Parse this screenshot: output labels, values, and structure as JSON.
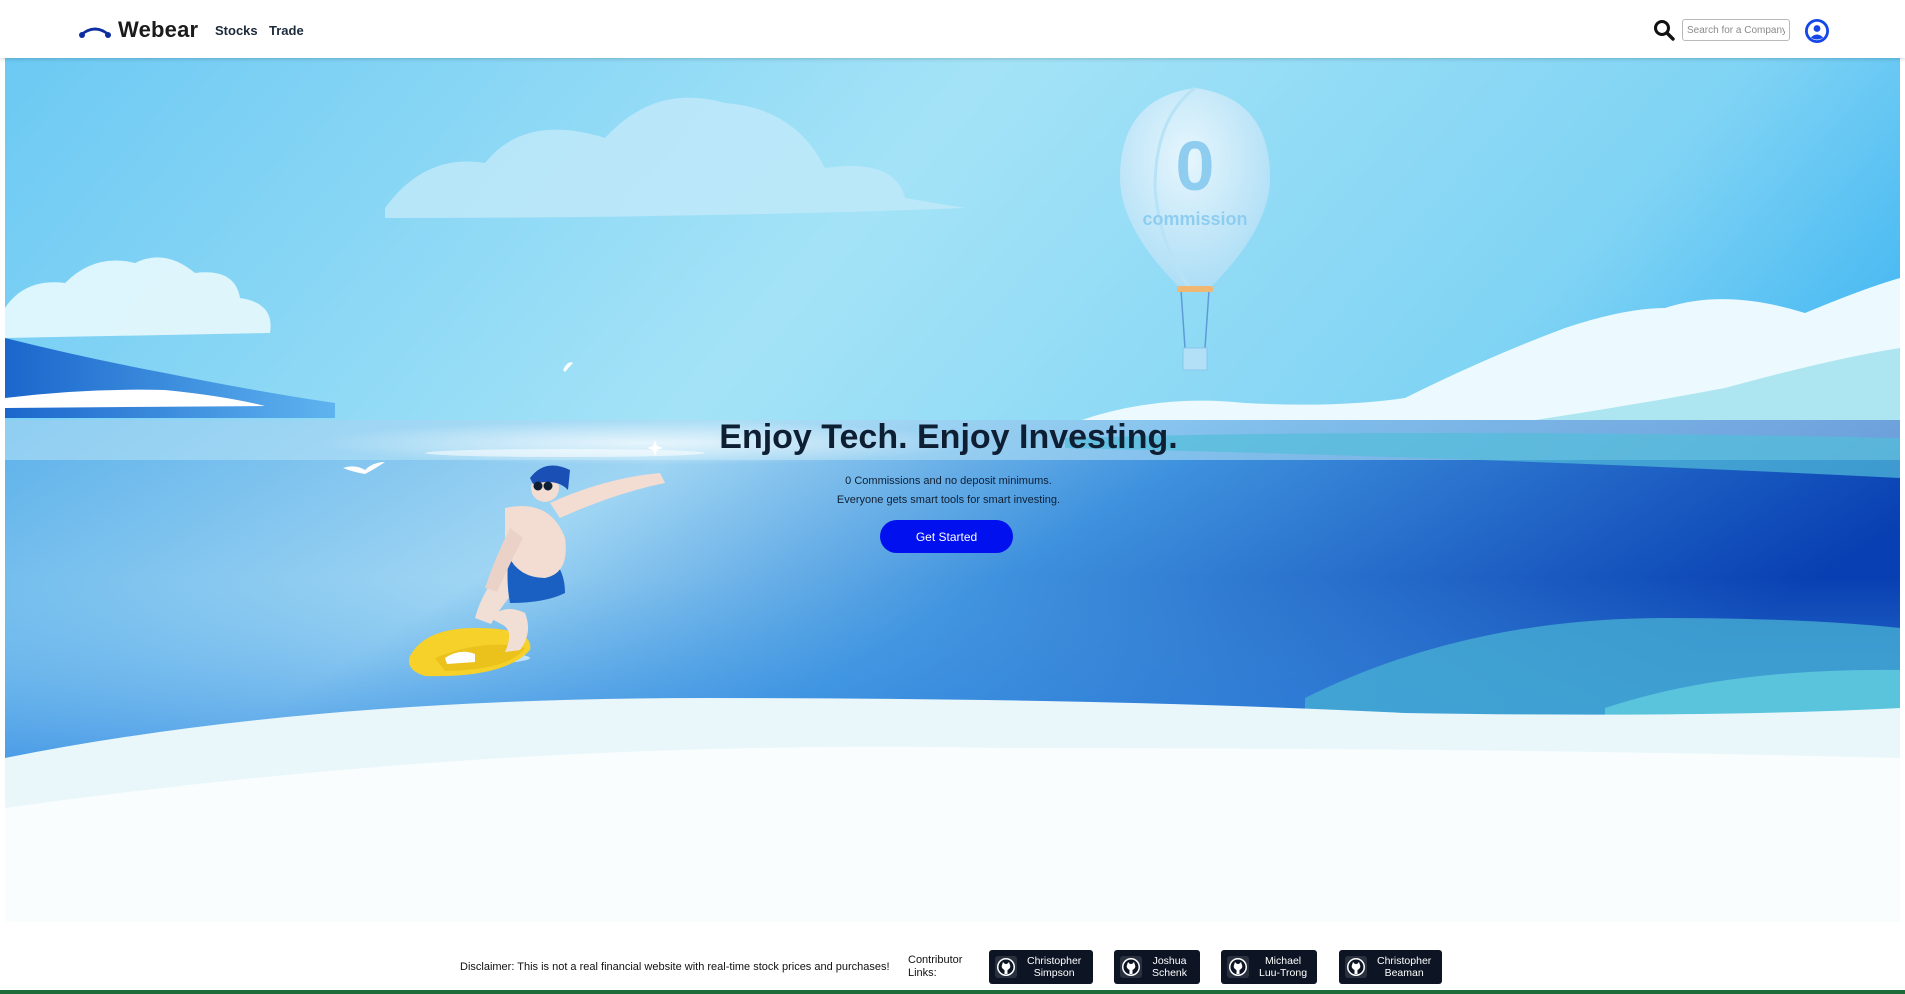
{
  "brand": {
    "name": "Webear",
    "logo_icon": "bear-arc-logo-icon"
  },
  "nav": {
    "links": [
      {
        "label": "Stocks"
      },
      {
        "label": "Trade"
      }
    ]
  },
  "search": {
    "icon": "search-icon",
    "placeholder": "Search for a Company",
    "value": ""
  },
  "user": {
    "icon": "user-circle-icon"
  },
  "hero": {
    "title": "Enjoy Tech. Enjoy Investing.",
    "subtitle_lines": [
      "0 Commissions and no deposit minimums.",
      "Everyone gets smart tools for smart investing."
    ],
    "cta_label": "Get Started",
    "balloon_number": "0",
    "balloon_text": "commission"
  },
  "footer": {
    "disclaimer": "Disclaimer: This is not a real financial website with real-time stock prices and purchases!",
    "contributors_label": "Contributor Links:",
    "contributors": [
      {
        "first": "Christopher",
        "last": "Simpson"
      },
      {
        "first": "Joshua",
        "last": "Schenk"
      },
      {
        "first": "Michael",
        "last": "Luu-Trong"
      },
      {
        "first": "Christopher",
        "last": "Beaman"
      }
    ]
  },
  "colors": {
    "accent": "#0010ee",
    "brand_blue": "#1447e6",
    "sky": "#8fd8f4",
    "sea_deep": "#0a4bbd",
    "badge_bg": "#0d1524"
  }
}
